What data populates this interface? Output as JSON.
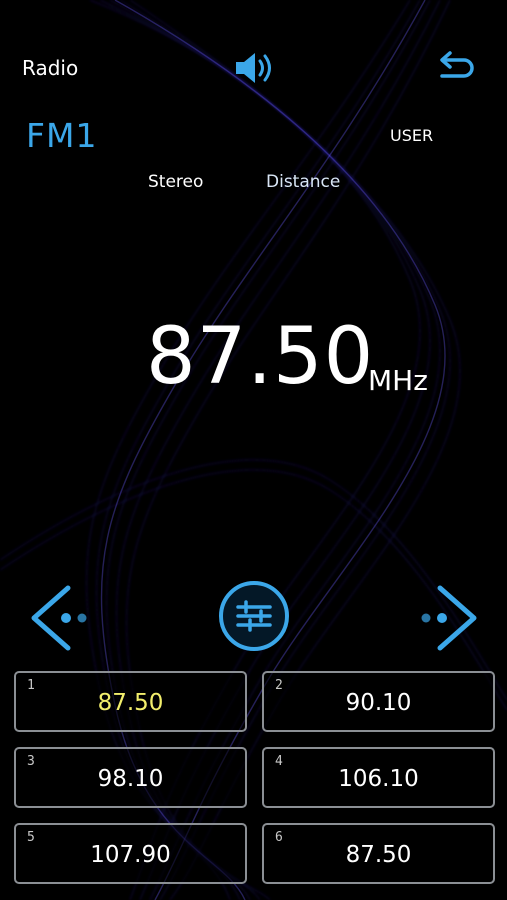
{
  "header": {
    "title": "Radio",
    "volume_icon": "speaker-volume-icon",
    "back_icon": "return-arrow-icon"
  },
  "status": {
    "band": "FM1",
    "mode": "USER",
    "stereo": "Stereo",
    "distance": "Distance"
  },
  "tuner": {
    "frequency": "87.50",
    "unit": "MHz"
  },
  "controls": {
    "seek_prev_icon": "chevron-left-icon",
    "settings_icon": "equalizer-sliders-icon",
    "seek_next_icon": "chevron-right-icon"
  },
  "presets": [
    {
      "number": "1",
      "freq": "87.50"
    },
    {
      "number": "2",
      "freq": "90.10"
    },
    {
      "number": "3",
      "freq": "98.10"
    },
    {
      "number": "4",
      "freq": "106.10"
    },
    {
      "number": "5",
      "freq": "107.90"
    },
    {
      "number": "6",
      "freq": "87.50"
    }
  ],
  "colors": {
    "accent_blue": "#3ba7e9",
    "active_preset": "#f2ee6c",
    "wave": "#4a3cff"
  }
}
